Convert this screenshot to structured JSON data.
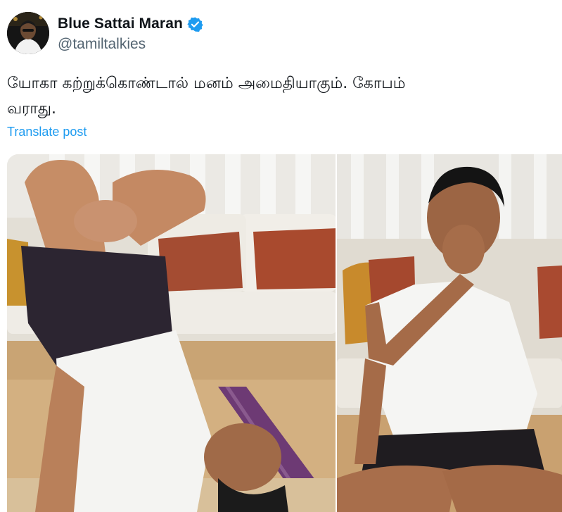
{
  "post": {
    "author": {
      "display_name": "Blue Sattai Maran",
      "handle": "@tamiltalkies",
      "verified": true,
      "avatar_icon": "profile-photo"
    },
    "text_lines": [
      "யோகா கற்றுக்கொண்டால் மனம் அமைதியாகும். கோபம்",
      "வராது."
    ],
    "translate_label": "Translate post",
    "media": [
      {
        "kind": "photo",
        "subject": "man doing shoulder-stand yoga pose on mat"
      },
      {
        "kind": "photo",
        "subject": "man seated cross-legged doing breathing exercise"
      }
    ]
  },
  "colors": {
    "text_primary": "#0f1419",
    "text_secondary": "#536471",
    "link_blue": "#1d9bf0",
    "verified_blue": "#1d9bf0"
  }
}
